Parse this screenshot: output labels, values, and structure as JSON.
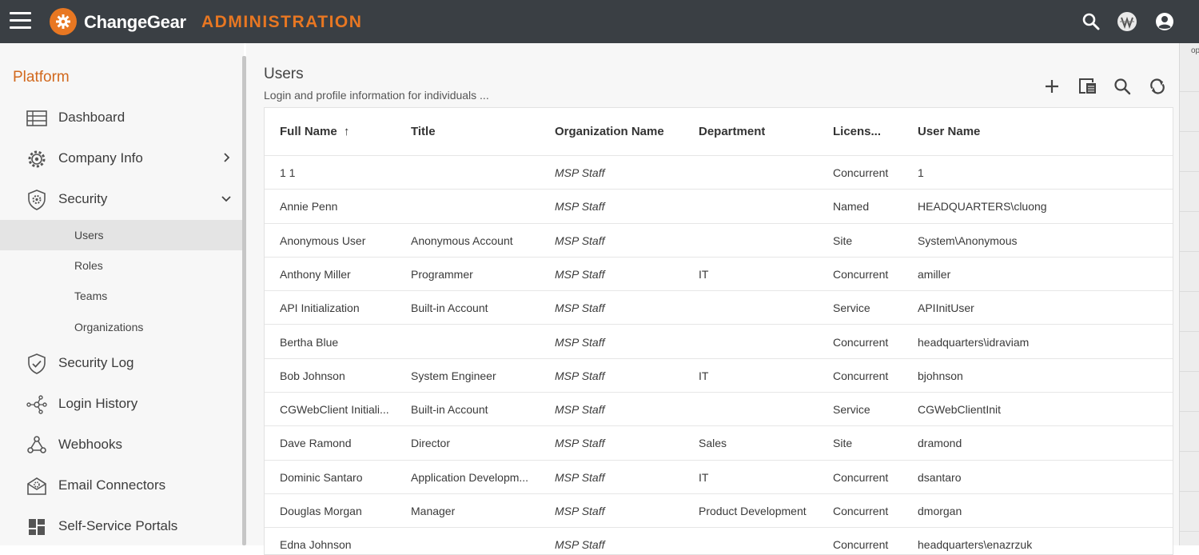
{
  "app": {
    "brand": "ChangeGear",
    "section": "ADMINISTRATION",
    "edge_text": "opi"
  },
  "sidebar": {
    "heading": "Platform",
    "items": [
      {
        "label": "Dashboard",
        "icon": "table-icon"
      },
      {
        "label": "Company Info",
        "icon": "gear-icon"
      },
      {
        "label": "Security",
        "icon": "shield-gear-icon"
      },
      {
        "label": "Security Log",
        "icon": "shield-check-icon"
      },
      {
        "label": "Login History",
        "icon": "network-icon"
      },
      {
        "label": "Webhooks",
        "icon": "webhook-icon"
      },
      {
        "label": "Email Connectors",
        "icon": "email-gear-icon"
      },
      {
        "label": "Self-Service Portals",
        "icon": "dashboard-tiles-icon"
      }
    ],
    "security_sub": [
      "Users",
      "Roles",
      "Teams",
      "Organizations"
    ],
    "active_sub": "Users"
  },
  "page": {
    "title": "Users",
    "subtitle": "Login and profile information for individuals ..."
  },
  "toolbar": [
    "add-icon",
    "export-icon",
    "search-icon",
    "refresh-icon"
  ],
  "table": {
    "columns": [
      "Full Name",
      "Title",
      "Organization Name",
      "Department",
      "Licens...",
      "User Name"
    ],
    "sort_indicator": "↑",
    "rows": [
      [
        "1 1",
        "",
        "MSP Staff",
        "",
        "Concurrent",
        "1"
      ],
      [
        "Annie Penn",
        "",
        "MSP Staff",
        "",
        "Named",
        "HEADQUARTERS\\cluong"
      ],
      [
        "Anonymous User",
        "Anonymous Account",
        "MSP Staff",
        "",
        "Site",
        "System\\Anonymous"
      ],
      [
        "Anthony Miller",
        "Programmer",
        "MSP Staff",
        "IT",
        "Concurrent",
        "amiller"
      ],
      [
        "API Initialization",
        "Built-in Account",
        "MSP Staff",
        "",
        "Service",
        "APIInitUser"
      ],
      [
        "Bertha Blue",
        "",
        "MSP Staff",
        "",
        "Concurrent",
        "headquarters\\idraviam"
      ],
      [
        "Bob Johnson",
        "System Engineer",
        "MSP Staff",
        "IT",
        "Concurrent",
        "bjohnson"
      ],
      [
        "CGWebClient Initiali...",
        "Built-in Account",
        "MSP Staff",
        "",
        "Service",
        "CGWebClientInit"
      ],
      [
        "Dave Ramond",
        "Director",
        "MSP Staff",
        "Sales",
        "Site",
        "dramond"
      ],
      [
        "Dominic Santaro",
        "Application Developm...",
        "MSP Staff",
        "IT",
        "Concurrent",
        "dsantaro"
      ],
      [
        "Douglas Morgan",
        "Manager",
        "MSP Staff",
        "Product Development",
        "Concurrent",
        "dmorgan"
      ],
      [
        "Edna Johnson",
        "",
        "MSP Staff",
        "",
        "Concurrent",
        "headquarters\\enazrzuk"
      ]
    ]
  }
}
